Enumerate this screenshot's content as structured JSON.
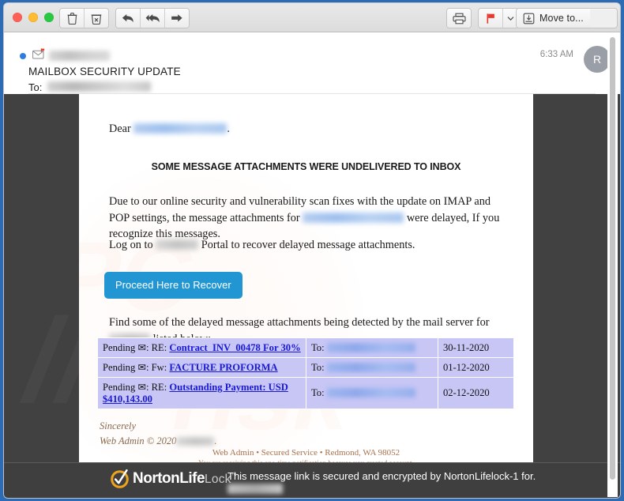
{
  "window": {
    "traffic_lights": [
      "close",
      "minimize",
      "zoom"
    ]
  },
  "toolbar": {
    "delete_label": "Delete",
    "junk_label": "Junk",
    "reply_label": "Reply",
    "reply_all_label": "Reply All",
    "forward_label": "Forward",
    "print_label": "Print",
    "flag_label": "Flag",
    "flag_menu_label": "v",
    "move_to_label": "Move to...",
    "flag_color": "#e8392c"
  },
  "message": {
    "sender": "",
    "subject": "MAILBOX SECURITY UPDATE",
    "to_label": "To:",
    "to": "",
    "time": "6:33 AM",
    "avatar_initial": "R",
    "unread": true
  },
  "email": {
    "greeting": "Dear",
    "greeting_suffix": ".",
    "headline": "SOME MESSAGE ATTACHMENTS WERE UNDELIVERED TO INBOX",
    "para1_a": "Due to our online security and vulnerability scan fixes with the update on IMAP and POP settings, the message attachments for",
    "para1_b": "were delayed, If you recognize this messages.",
    "para2_a": "Log on to",
    "para2_b": "Portal to recover delayed message attachments.",
    "cta_label": "Proceed Here to Recover",
    "cta_color": "#2196d3",
    "para3_a": "Find some of the delayed message attachments being detected by the mail server for",
    "para3_b": "listed below:",
    "table": {
      "rows": [
        {
          "status": "Pending",
          "mail_glyph": "✉",
          "separator": ":",
          "prefix": "RE:",
          "link": "Contract_INV_00478 For 30%",
          "to_label": "To:",
          "to": "",
          "date": "30-11-2020"
        },
        {
          "status": "Pending",
          "mail_glyph": "✉",
          "separator": ":",
          "prefix": "Fw:",
          "link": "FACTURE PROFORMA",
          "to_label": "To:",
          "to": "",
          "date": "01-12-2020"
        },
        {
          "status": "Pending",
          "mail_glyph": "✉",
          "separator": ":",
          "prefix": "RE:",
          "link": "Outstanding Payment: USD $410,143.00",
          "to_label": "To:",
          "to": "",
          "date": "02-12-2020"
        }
      ]
    },
    "sign_off_1": "Sincerely",
    "sign_off_2": "Web Admin © 2020",
    "sign_off_2_suffix": ".",
    "footer_line1": "Web Admin • Secured Service • Redmond, WA 98052",
    "footer_line2": "You are receiving this one-time notification because you created account."
  },
  "norton": {
    "brand_1": "Norton",
    "brand_2": "Life",
    "brand_3": "Lock",
    "trademark": "™",
    "message": "This message link is secured and encrypted by NortonLifelock-1 for.",
    "badge_color": "#f0a41e"
  }
}
